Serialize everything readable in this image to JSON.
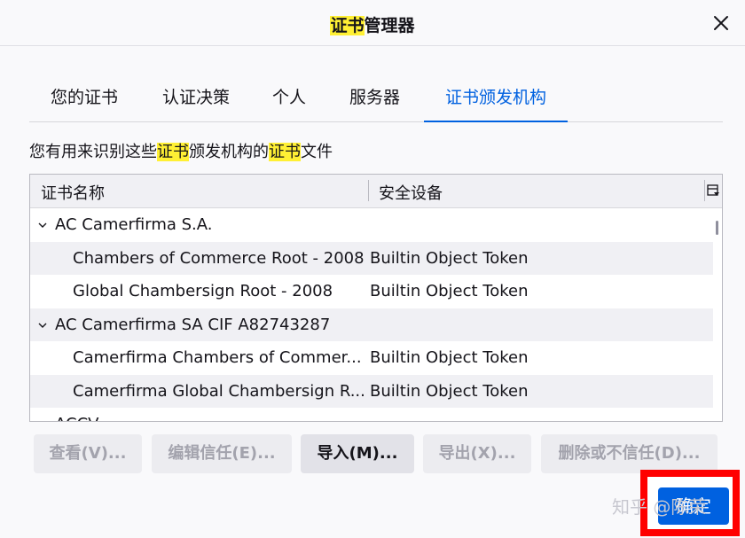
{
  "window": {
    "title_prefix": "证书",
    "title_suffix": "管理器"
  },
  "tabs": [
    {
      "label": "您的证书"
    },
    {
      "label": "认证决策"
    },
    {
      "label": "个人"
    },
    {
      "label": "服务器"
    },
    {
      "label": "证书颁发机构",
      "active": true
    }
  ],
  "description": {
    "part1": "您有用来识别这些",
    "part2": "证书",
    "part3": "颁发机构的",
    "part4": "证书",
    "part5": "文件"
  },
  "table": {
    "columns": [
      "证书名称",
      "安全设备"
    ],
    "rows": [
      {
        "type": "group",
        "name": "AC Camerfirma S.A.",
        "device": ""
      },
      {
        "type": "item",
        "name": "Chambers of Commerce Root - 2008",
        "device": "Builtin Object Token"
      },
      {
        "type": "item",
        "name": "Global Chambersign Root - 2008",
        "device": "Builtin Object Token"
      },
      {
        "type": "group",
        "name": "AC Camerfirma SA CIF A82743287",
        "device": ""
      },
      {
        "type": "item",
        "name": "Camerfirma Chambers of Commer...",
        "device": "Builtin Object Token"
      },
      {
        "type": "item",
        "name": "Camerfirma Global Chambersign R...",
        "device": "Builtin Object Token"
      },
      {
        "type": "group",
        "name": "ACCV",
        "device": ""
      }
    ]
  },
  "buttons": {
    "view": "查看(V)...",
    "edit_trust": "编辑信任(E)...",
    "import": "导入(M)...",
    "export": "导出(X)...",
    "delete": "删除或不信任(D)...",
    "ok": "确定"
  },
  "watermark": "知乎 @陈荣",
  "colors": {
    "accent": "#0061e0",
    "highlight": "#fff034",
    "annotation": "#ff0000"
  }
}
